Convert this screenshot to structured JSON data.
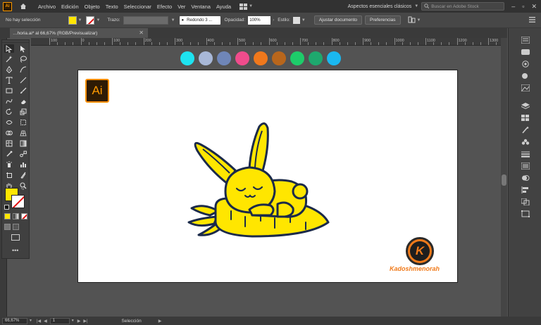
{
  "app": {
    "logo": "Ai"
  },
  "menu": [
    "Archivo",
    "Edición",
    "Objeto",
    "Texto",
    "Seleccionar",
    "Efecto",
    "Ver",
    "Ventana",
    "Ayuda"
  ],
  "workspace": {
    "label": "Aspectos esenciales clásicos",
    "search_placeholder": "Buscar en Adobe Stock"
  },
  "control": {
    "selection_status": "No hay selección",
    "stroke_label": "Trazo:",
    "brush_select": "Redondo 3 ...",
    "opacity_label": "Opacidad:",
    "opacity_value": "100%",
    "style_label": "Estilo:",
    "fill_color": "#ffe600",
    "btn_adjust": "Ajustar documento",
    "btn_prefs": "Preferencias"
  },
  "document": {
    "tab_title": "…horia.ai* al 66,67% (RGB/Previsualizar)"
  },
  "ruler": {
    "labels": [
      "100",
      "0",
      "100",
      "200",
      "300",
      "400",
      "500",
      "600",
      "700",
      "800",
      "900",
      "1000",
      "1100",
      "1200",
      "1300"
    ]
  },
  "palette": [
    "#1ee3f0",
    "#a8b8d8",
    "#6f86b8",
    "#f04c8c",
    "#f0781c",
    "#b8661c",
    "#1ecc6a",
    "#1ea86e",
    "#1ab8f0"
  ],
  "artwork": {
    "ai_logo_text": "Ai",
    "k_logo_letter": "K",
    "signature": "Kadoshmenorah"
  },
  "status": {
    "zoom": "66,67%",
    "page": "1",
    "tool": "Selección"
  }
}
